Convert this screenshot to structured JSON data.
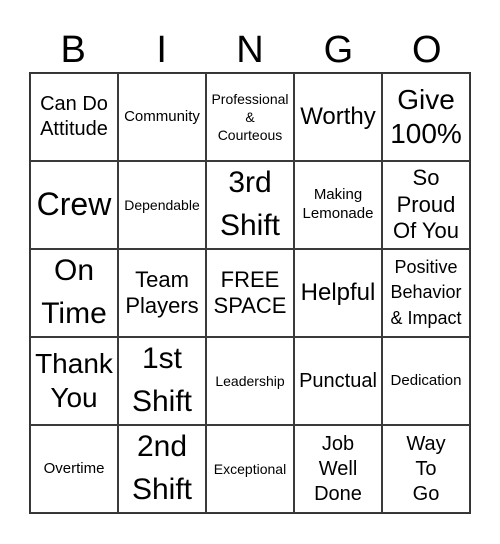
{
  "header": {
    "letters": [
      "B",
      "I",
      "N",
      "G",
      "O"
    ]
  },
  "board": {
    "rows": [
      [
        "Can Do\nAttitude",
        "Community",
        "Professional\n&\nCourteous",
        "Worthy",
        "Give\n100%"
      ],
      [
        "Crew",
        "Dependable",
        "3rd\nShift",
        "Making\nLemonade",
        "So\nProud\nOf You"
      ],
      [
        "On\nTime",
        "Team\nPlayers",
        "FREE\nSPACE",
        "Helpful",
        "Positive\nBehavior\n& Impact"
      ],
      [
        "Thank\nYou",
        "1st\nShift",
        "Leadership",
        "Punctual",
        "Dedication"
      ],
      [
        "Overtime",
        "2nd\nShift",
        "Exceptional",
        "Job\nWell\nDone",
        "Way\nTo\nGo"
      ]
    ]
  }
}
